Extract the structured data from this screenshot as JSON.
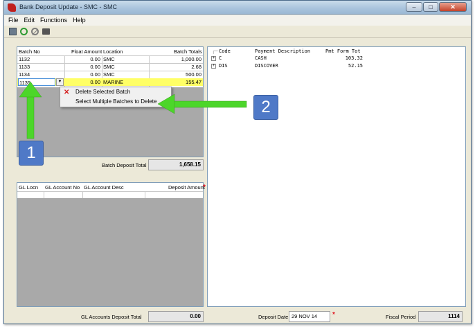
{
  "window": {
    "title": "Bank Deposit Update - SMC - SMC"
  },
  "menu": [
    "File",
    "Edit",
    "Functions",
    "Help"
  ],
  "toolbar": [
    "save-icon",
    "refresh-icon",
    "cancel-icon",
    "print-icon"
  ],
  "batches": {
    "headers": [
      "Batch No",
      "Float Amount",
      "Location",
      "Batch Totals"
    ],
    "rows": [
      {
        "batch": "1132",
        "float": "0.00",
        "location": "SMC",
        "total": "1,000.00"
      },
      {
        "batch": "1133",
        "float": "0.00",
        "location": "SMC",
        "total": "2.68"
      },
      {
        "batch": "1134",
        "float": "0.00",
        "location": "SMC",
        "total": "500.00"
      },
      {
        "batch": "1135",
        "float": "0.00",
        "location": "MARINE",
        "total": "155.47"
      }
    ],
    "deposit_total_label": "Batch Deposit Total",
    "deposit_total": "1,658.15"
  },
  "context_menu": {
    "items": [
      "Delete Selected Batch",
      "Select Multiple Batches to Delete"
    ]
  },
  "gl": {
    "headers": [
      "GL Locn",
      "GL Account No",
      "GL Account Desc",
      "Deposit Amount"
    ],
    "total_label": "GL Accounts Deposit Total",
    "total": "0.00"
  },
  "payments": {
    "headers": [
      "Code",
      "Payment Description",
      "Pmt Form Tot"
    ],
    "rows": [
      {
        "code": "C",
        "desc": "CASH",
        "amount": "103.32"
      },
      {
        "code": "DIS",
        "desc": "DISCOVER",
        "amount": "52.15"
      }
    ]
  },
  "footer": {
    "deposit_date_label": "Deposit Date",
    "deposit_date": "29 NOV 14",
    "fiscal_period_label": "Fiscal Period",
    "fiscal_period": "1114"
  },
  "callouts": [
    "1",
    "2"
  ],
  "colors": {
    "highlight_row": "#ffff66",
    "arrow": "#4cd62a",
    "callout": "#4f79c7"
  }
}
